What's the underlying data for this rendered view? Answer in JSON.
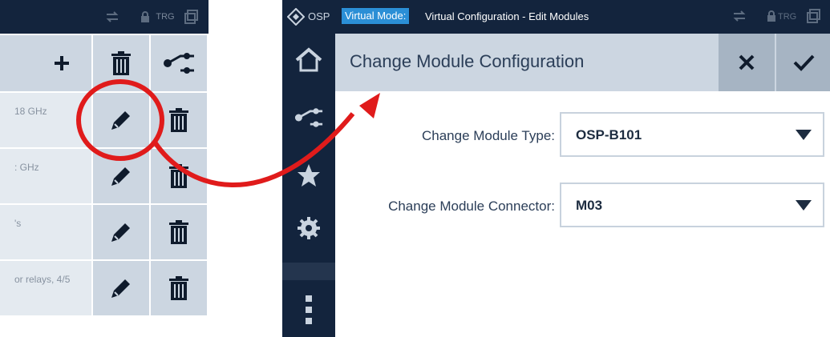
{
  "left_panel": {
    "toolbar": {
      "trg_label": "TRG"
    },
    "rows": [
      {
        "label": "18 GHz"
      },
      {
        "label": ": GHz"
      },
      {
        "label": "'s"
      },
      {
        "label": "or relays, 4/5"
      }
    ]
  },
  "topbar": {
    "brand": "OSP",
    "mode_badge": "Virtual Mode:",
    "title": "Virtual Configuration - Edit Modules",
    "trg_label": "TRG"
  },
  "dialog": {
    "title": "Change Module Configuration",
    "fields": [
      {
        "label": "Change Module Type:",
        "value": "OSP-B101"
      },
      {
        "label": "Change Module Connector:",
        "value": "M03"
      }
    ]
  },
  "colors": {
    "topbar_bg": "#13243d",
    "header_bg": "#ccd6e1",
    "button_bg": "#a6b4c3",
    "mode_badge_bg": "#2b8fd6",
    "annotation_red": "#e01b1b"
  },
  "icons": [
    "plus-icon",
    "trash-icon",
    "connection-icon",
    "pencil-icon",
    "home-icon",
    "star-icon",
    "gear-icon",
    "more-icon",
    "close-icon",
    "check-icon",
    "trg-lock-icon",
    "swap-icon"
  ]
}
